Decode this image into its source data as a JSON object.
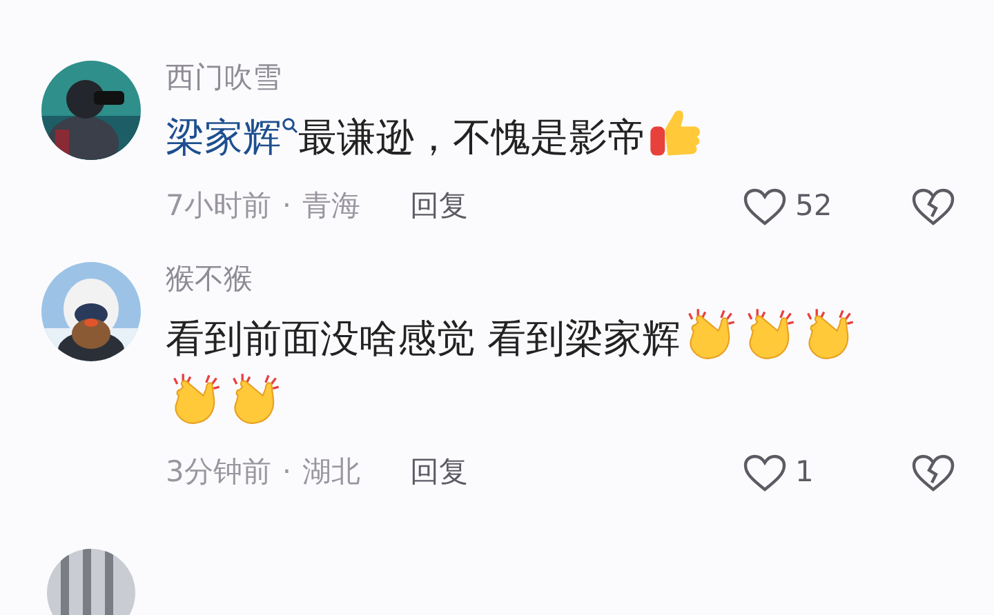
{
  "comments": [
    {
      "username": "西门吹雪",
      "body": [
        {
          "kind": "mention",
          "text": "梁家辉"
        },
        {
          "kind": "text",
          "text": "最谦逊，不愧是影帝"
        },
        {
          "kind": "thumbs-up"
        }
      ],
      "time": "7小时前",
      "separator": "·",
      "location": "青海",
      "reply": "回复",
      "likes": "52"
    },
    {
      "username": "猴不猴",
      "body": [
        {
          "kind": "text",
          "text": "看到前面没啥感觉 看到梁家辉"
        },
        {
          "kind": "clap"
        },
        {
          "kind": "clap"
        },
        {
          "kind": "clap"
        },
        {
          "kind": "clap"
        },
        {
          "kind": "clap"
        }
      ],
      "time": "3分钟前",
      "separator": "·",
      "location": "湖北",
      "reply": "回复",
      "likes": "1"
    }
  ]
}
